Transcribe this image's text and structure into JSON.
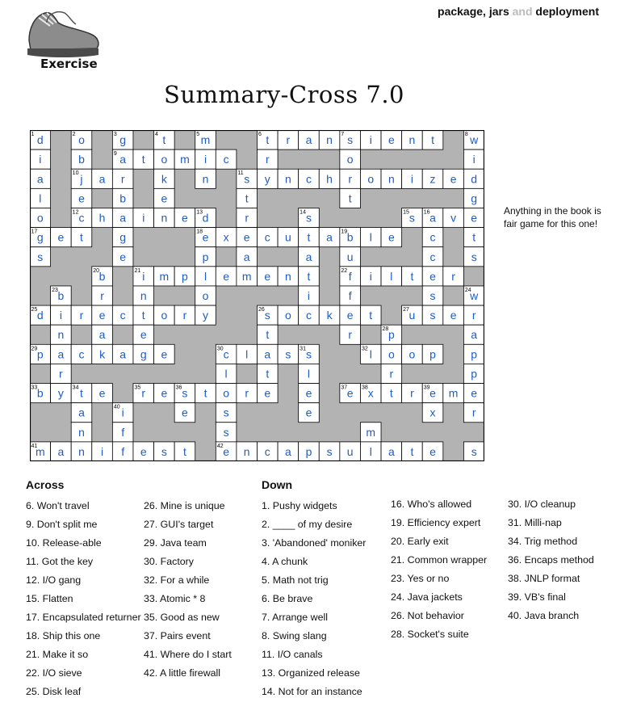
{
  "header": {
    "part1": "package, jars",
    "part2": "and",
    "part3": "deployment"
  },
  "logo": {
    "label": "Exercise",
    "icon": "sneakers-icon"
  },
  "title": "Summary-Cross 7.0",
  "hint": "Anything in the book is fair game for this one!",
  "colors": {
    "letter": "#1e5cc7",
    "block": "#b3b3b3",
    "line": "#000000"
  },
  "grid": {
    "rows": [
      "??????.?????????.?",
      "????????.????????.",
      "????.????????????.",
      "????..?????.???????",
      "????..?????.???????",
      "????..??.??.???.???",
      "......???????.???.?",
      "...??...???..?.???.",
      "????????????.???.??",
      "..??.????.?..???.??",
      "???????.??????..???",
      "..?.?....?????.?.??",
      "???????????..???????",
      "...?..????.?..?.??.?",
      "???????.???????????."
    ],
    "cells": [
      {
        "r": 0,
        "c": 0,
        "n": "1",
        "l": "d"
      },
      {
        "r": 0,
        "c": 2,
        "n": "2",
        "l": "o"
      },
      {
        "r": 0,
        "c": 4,
        "n": "3",
        "l": "g"
      },
      {
        "r": 0,
        "c": 6,
        "n": "4",
        "l": "t"
      },
      {
        "r": 0,
        "c": 8,
        "n": "5",
        "l": "m"
      },
      {
        "r": 0,
        "c": 11,
        "n": "6",
        "l": "t"
      },
      {
        "r": 0,
        "c": 12,
        "l": "r"
      },
      {
        "r": 0,
        "c": 13,
        "l": "a"
      },
      {
        "r": 0,
        "c": 14,
        "l": "n"
      },
      {
        "r": 0,
        "c": 15,
        "n": "7",
        "l": "s"
      },
      {
        "r": 0,
        "c": 16,
        "l": "i"
      },
      {
        "r": 0,
        "c": 17,
        "l": "e"
      },
      {
        "r": 0,
        "c": 18,
        "l": "n"
      },
      {
        "r": 0,
        "c": 19,
        "l": "t"
      },
      {
        "r": 0,
        "c": 21,
        "n": "8",
        "l": "w"
      },
      {
        "r": 1,
        "c": 0,
        "l": "i"
      },
      {
        "r": 1,
        "c": 2,
        "l": "b"
      },
      {
        "r": 1,
        "c": 4,
        "n": "9",
        "l": "a"
      },
      {
        "r": 1,
        "c": 5,
        "l": "t"
      },
      {
        "r": 1,
        "c": 6,
        "l": "o"
      },
      {
        "r": 1,
        "c": 7,
        "l": "m"
      },
      {
        "r": 1,
        "c": 8,
        "l": "i"
      },
      {
        "r": 1,
        "c": 9,
        "l": "c"
      },
      {
        "r": 1,
        "c": 11,
        "l": "r"
      },
      {
        "r": 1,
        "c": 15,
        "l": "o"
      },
      {
        "r": 1,
        "c": 21,
        "l": "i"
      },
      {
        "r": 2,
        "c": 0,
        "l": "a"
      },
      {
        "r": 2,
        "c": 2,
        "n": "10",
        "l": "j"
      },
      {
        "r": 2,
        "c": 3,
        "l": "a"
      },
      {
        "r": 2,
        "c": 4,
        "l": "r"
      },
      {
        "r": 2,
        "c": 6,
        "l": "k"
      },
      {
        "r": 2,
        "c": 8,
        "l": "n"
      },
      {
        "r": 2,
        "c": 10,
        "n": "11",
        "l": "s"
      },
      {
        "r": 2,
        "c": 11,
        "l": "y"
      },
      {
        "r": 2,
        "c": 12,
        "l": "n"
      },
      {
        "r": 2,
        "c": 13,
        "l": "c"
      },
      {
        "r": 2,
        "c": 14,
        "l": "h"
      },
      {
        "r": 2,
        "c": 15,
        "l": "r"
      },
      {
        "r": 2,
        "c": 16,
        "l": "o"
      },
      {
        "r": 2,
        "c": 17,
        "l": "n"
      },
      {
        "r": 2,
        "c": 18,
        "l": "i"
      },
      {
        "r": 2,
        "c": 19,
        "l": "z"
      },
      {
        "r": 2,
        "c": 20,
        "l": "e"
      },
      {
        "r": 2,
        "c": 21,
        "l": "d"
      },
      {
        "r": 3,
        "c": 0,
        "l": "l"
      },
      {
        "r": 3,
        "c": 2,
        "l": "e"
      },
      {
        "r": 3,
        "c": 4,
        "l": "b"
      },
      {
        "r": 3,
        "c": 6,
        "l": "e"
      },
      {
        "r": 3,
        "c": 10,
        "l": "t"
      },
      {
        "r": 3,
        "c": 15,
        "l": "t"
      },
      {
        "r": 3,
        "c": 21,
        "l": "g"
      },
      {
        "r": 4,
        "c": 0,
        "l": "o"
      },
      {
        "r": 4,
        "c": 2,
        "n": "12",
        "l": "c"
      },
      {
        "r": 4,
        "c": 3,
        "l": "h"
      },
      {
        "r": 4,
        "c": 4,
        "l": "a"
      },
      {
        "r": 4,
        "c": 5,
        "l": "i"
      },
      {
        "r": 4,
        "c": 6,
        "l": "n"
      },
      {
        "r": 4,
        "c": 7,
        "l": "e"
      },
      {
        "r": 4,
        "c": 8,
        "n": "13",
        "l": "d"
      },
      {
        "r": 4,
        "c": 10,
        "l": "r"
      },
      {
        "r": 4,
        "c": 13,
        "n": "14",
        "l": "s"
      },
      {
        "r": 4,
        "c": 18,
        "n": "15",
        "l": "s"
      },
      {
        "r": 4,
        "c": 19,
        "n": "16",
        "l": "a"
      },
      {
        "r": 4,
        "c": 20,
        "l": "v"
      },
      {
        "r": 4,
        "c": 21,
        "l": "e"
      },
      {
        "r": 5,
        "c": 0,
        "n": "17",
        "l": "g"
      },
      {
        "r": 5,
        "c": 1,
        "l": "e"
      },
      {
        "r": 5,
        "c": 2,
        "l": "t"
      },
      {
        "r": 5,
        "c": 4,
        "l": "g"
      },
      {
        "r": 5,
        "c": 8,
        "n": "18",
        "l": "e"
      },
      {
        "r": 5,
        "c": 9,
        "l": "x"
      },
      {
        "r": 5,
        "c": 10,
        "l": "e"
      },
      {
        "r": 5,
        "c": 11,
        "l": "c"
      },
      {
        "r": 5,
        "c": 12,
        "l": "u"
      },
      {
        "r": 5,
        "c": 13,
        "l": "t"
      },
      {
        "r": 5,
        "c": 14,
        "l": "a"
      },
      {
        "r": 5,
        "c": 15,
        "n": "19",
        "l": "b"
      },
      {
        "r": 5,
        "c": 16,
        "l": "l"
      },
      {
        "r": 5,
        "c": 17,
        "l": "e"
      },
      {
        "r": 5,
        "c": 19,
        "l": "c"
      },
      {
        "r": 5,
        "c": 21,
        "l": "t"
      },
      {
        "r": 6,
        "c": 0,
        "l": "s"
      },
      {
        "r": 6,
        "c": 4,
        "l": "e"
      },
      {
        "r": 6,
        "c": 8,
        "l": "p"
      },
      {
        "r": 6,
        "c": 10,
        "l": "a"
      },
      {
        "r": 6,
        "c": 13,
        "l": "a"
      },
      {
        "r": 6,
        "c": 15,
        "l": "u"
      },
      {
        "r": 6,
        "c": 19,
        "l": "c"
      },
      {
        "r": 6,
        "c": 21,
        "l": "s"
      },
      {
        "r": 7,
        "c": 3,
        "n": "20",
        "l": "b"
      },
      {
        "r": 7,
        "c": 5,
        "n": "21",
        "l": "i"
      },
      {
        "r": 7,
        "c": 6,
        "l": "m"
      },
      {
        "r": 7,
        "c": 7,
        "l": "p"
      },
      {
        "r": 7,
        "c": 8,
        "l": "l"
      },
      {
        "r": 7,
        "c": 9,
        "l": "e"
      },
      {
        "r": 7,
        "c": 10,
        "l": "m"
      },
      {
        "r": 7,
        "c": 11,
        "l": "e"
      },
      {
        "r": 7,
        "c": 12,
        "l": "n"
      },
      {
        "r": 7,
        "c": 13,
        "l": "t"
      },
      {
        "r": 7,
        "c": 15,
        "n": "22",
        "l": "f"
      },
      {
        "r": 7,
        "c": 16,
        "l": "i"
      },
      {
        "r": 7,
        "c": 17,
        "l": "l"
      },
      {
        "r": 7,
        "c": 18,
        "l": "t"
      },
      {
        "r": 7,
        "c": 19,
        "l": "e"
      },
      {
        "r": 7,
        "c": 20,
        "l": "r"
      },
      {
        "r": 8,
        "c": 1,
        "n": "23",
        "l": "b"
      },
      {
        "r": 8,
        "c": 3,
        "l": "r"
      },
      {
        "r": 8,
        "c": 5,
        "l": "n"
      },
      {
        "r": 8,
        "c": 8,
        "l": "o"
      },
      {
        "r": 8,
        "c": 13,
        "l": "i"
      },
      {
        "r": 8,
        "c": 15,
        "l": "f"
      },
      {
        "r": 8,
        "c": 19,
        "l": "s"
      },
      {
        "r": 8,
        "c": 21,
        "n": "24",
        "l": "w"
      },
      {
        "r": 9,
        "c": 0,
        "n": "25",
        "l": "d"
      },
      {
        "r": 9,
        "c": 1,
        "l": "i"
      },
      {
        "r": 9,
        "c": 2,
        "l": "r"
      },
      {
        "r": 9,
        "c": 3,
        "l": "e"
      },
      {
        "r": 9,
        "c": 4,
        "l": "c"
      },
      {
        "r": 9,
        "c": 5,
        "l": "t"
      },
      {
        "r": 9,
        "c": 6,
        "l": "o"
      },
      {
        "r": 9,
        "c": 7,
        "l": "r"
      },
      {
        "r": 9,
        "c": 8,
        "l": "y"
      },
      {
        "r": 9,
        "c": 11,
        "n": "26",
        "l": "s"
      },
      {
        "r": 9,
        "c": 12,
        "l": "o"
      },
      {
        "r": 9,
        "c": 13,
        "l": "c"
      },
      {
        "r": 9,
        "c": 14,
        "l": "k"
      },
      {
        "r": 9,
        "c": 15,
        "l": "e"
      },
      {
        "r": 9,
        "c": 16,
        "l": "t"
      },
      {
        "r": 9,
        "c": 18,
        "n": "27",
        "l": "u"
      },
      {
        "r": 9,
        "c": 19,
        "l": "s"
      },
      {
        "r": 9,
        "c": 20,
        "l": "e"
      },
      {
        "r": 9,
        "c": 21,
        "l": "r"
      },
      {
        "r": 10,
        "c": 1,
        "l": "n"
      },
      {
        "r": 10,
        "c": 3,
        "l": "a"
      },
      {
        "r": 10,
        "c": 5,
        "l": "e"
      },
      {
        "r": 10,
        "c": 11,
        "l": "t"
      },
      {
        "r": 10,
        "c": 15,
        "l": "r"
      },
      {
        "r": 10,
        "c": 17,
        "n": "28",
        "l": "p"
      },
      {
        "r": 10,
        "c": 21,
        "l": "a"
      },
      {
        "r": 11,
        "c": 0,
        "n": "29",
        "l": "p"
      },
      {
        "r": 11,
        "c": 1,
        "l": "a"
      },
      {
        "r": 11,
        "c": 2,
        "l": "c"
      },
      {
        "r": 11,
        "c": 3,
        "l": "k"
      },
      {
        "r": 11,
        "c": 4,
        "l": "a"
      },
      {
        "r": 11,
        "c": 5,
        "l": "g"
      },
      {
        "r": 11,
        "c": 6,
        "l": "e"
      },
      {
        "r": 11,
        "c": 9,
        "n": "30",
        "l": "c"
      },
      {
        "r": 11,
        "c": 10,
        "l": "l"
      },
      {
        "r": 11,
        "c": 11,
        "l": "a"
      },
      {
        "r": 11,
        "c": 12,
        "l": "s"
      },
      {
        "r": 11,
        "c": 13,
        "n": "31",
        "l": "s"
      },
      {
        "r": 11,
        "c": 16,
        "n": "32",
        "l": "l"
      },
      {
        "r": 11,
        "c": 17,
        "l": "o"
      },
      {
        "r": 11,
        "c": 18,
        "l": "o"
      },
      {
        "r": 11,
        "c": 19,
        "l": "p"
      },
      {
        "r": 11,
        "c": 21,
        "l": "p"
      },
      {
        "r": 12,
        "c": 1,
        "l": "r"
      },
      {
        "r": 12,
        "c": 9,
        "l": "l"
      },
      {
        "r": 12,
        "c": 11,
        "l": "t"
      },
      {
        "r": 12,
        "c": 13,
        "l": "l"
      },
      {
        "r": 12,
        "c": 17,
        "l": "r"
      },
      {
        "r": 12,
        "c": 21,
        "l": "p"
      },
      {
        "r": 13,
        "c": 0,
        "n": "33",
        "l": "b"
      },
      {
        "r": 13,
        "c": 1,
        "l": "y"
      },
      {
        "r": 13,
        "c": 2,
        "n": "34",
        "l": "t"
      },
      {
        "r": 13,
        "c": 3,
        "l": "e"
      },
      {
        "r": 13,
        "c": 5,
        "n": "35",
        "l": "r"
      },
      {
        "r": 13,
        "c": 6,
        "l": "e"
      },
      {
        "r": 13,
        "c": 7,
        "n": "36",
        "l": "s"
      },
      {
        "r": 13,
        "c": 8,
        "l": "t"
      },
      {
        "r": 13,
        "c": 9,
        "l": "o"
      },
      {
        "r": 13,
        "c": 10,
        "l": "r"
      },
      {
        "r": 13,
        "c": 11,
        "l": "e"
      },
      {
        "r": 13,
        "c": 13,
        "l": "e"
      },
      {
        "r": 13,
        "c": 15,
        "n": "37",
        "l": "e"
      },
      {
        "r": 13,
        "c": 16,
        "n": "38",
        "l": "x"
      },
      {
        "r": 13,
        "c": 17,
        "l": "t"
      },
      {
        "r": 13,
        "c": 18,
        "l": "r"
      },
      {
        "r": 13,
        "c": 19,
        "n": "39",
        "l": "e"
      },
      {
        "r": 13,
        "c": 20,
        "l": "m"
      },
      {
        "r": 13,
        "c": 21,
        "l": "e"
      },
      {
        "r": 14,
        "c": 2,
        "l": "a"
      },
      {
        "r": 14,
        "c": 4,
        "n": "40",
        "l": "i"
      },
      {
        "r": 14,
        "c": 7,
        "l": "e"
      },
      {
        "r": 14,
        "c": 9,
        "l": "s"
      },
      {
        "r": 14,
        "c": 13,
        "l": "e"
      },
      {
        "r": 14,
        "c": 19,
        "l": "x"
      },
      {
        "r": 14,
        "c": 21,
        "l": "r"
      },
      {
        "r": 15,
        "c": 2,
        "l": "n"
      },
      {
        "r": 15,
        "c": 4,
        "l": "f"
      },
      {
        "r": 15,
        "c": 9,
        "l": "s"
      },
      {
        "r": 15,
        "c": 16,
        "l": "m"
      },
      {
        "r": 16,
        "c": 0,
        "n": "41",
        "l": "m"
      },
      {
        "r": 16,
        "c": 1,
        "l": "a"
      },
      {
        "r": 16,
        "c": 2,
        "l": "n"
      },
      {
        "r": 16,
        "c": 3,
        "l": "i"
      },
      {
        "r": 16,
        "c": 4,
        "l": "f"
      },
      {
        "r": 16,
        "c": 5,
        "l": "e"
      },
      {
        "r": 16,
        "c": 6,
        "l": "s"
      },
      {
        "r": 16,
        "c": 7,
        "l": "t"
      },
      {
        "r": 16,
        "c": 9,
        "n": "42",
        "l": "e"
      },
      {
        "r": 16,
        "c": 10,
        "l": "n"
      },
      {
        "r": 16,
        "c": 11,
        "l": "c"
      },
      {
        "r": 16,
        "c": 12,
        "l": "a"
      },
      {
        "r": 16,
        "c": 13,
        "l": "p"
      },
      {
        "r": 16,
        "c": 14,
        "l": "s"
      },
      {
        "r": 16,
        "c": 15,
        "l": "u"
      },
      {
        "r": 16,
        "c": 16,
        "l": "l"
      },
      {
        "r": 16,
        "c": 17,
        "l": "a"
      },
      {
        "r": 16,
        "c": 18,
        "l": "t"
      },
      {
        "r": 16,
        "c": 19,
        "l": "e"
      },
      {
        "r": 16,
        "c": 21,
        "l": "s"
      }
    ]
  },
  "across": {
    "heading": "Across",
    "col1": [
      "6. Won't travel",
      "9. Don't split me",
      "10. Release-able",
      "11. Got the key",
      "12. I/O gang",
      "15. Flatten",
      "17. Encapsulated returner",
      "18. Ship this one",
      "21. Make it so",
      "22. I/O sieve",
      "25. Disk leaf"
    ],
    "col2": [
      "26. Mine is unique",
      "27. GUI's target",
      "29. Java team",
      "30. Factory",
      "32.  For a while",
      "33. Atomic * 8",
      "35. Good as new",
      "37. Pairs event",
      "41. Where do I start",
      "42. A little firewall"
    ]
  },
  "down": {
    "heading": "Down",
    "col1": [
      "1. Pushy widgets",
      "2. ____ of my desire",
      "3. 'Abandoned' moniker",
      "4. A chunk",
      "5. Math not trig",
      "6. Be brave",
      "7. Arrange well",
      "8. Swing slang",
      "11. I/O canals",
      "13. Organized release",
      "14. Not for an instance"
    ],
    "col2": [
      "16. Who's allowed",
      "19. Efficiency expert",
      "20. Early exit",
      "21. Common wrapper",
      "23. Yes or no",
      "24. Java jackets",
      "26. Not behavior",
      "28. Socket's suite"
    ],
    "col3": [
      "30. I/O cleanup",
      "31. Milli-nap",
      "34. Trig method",
      "36. Encaps method",
      "38. JNLP format",
      "39. VB's final",
      "40. Java branch"
    ]
  }
}
